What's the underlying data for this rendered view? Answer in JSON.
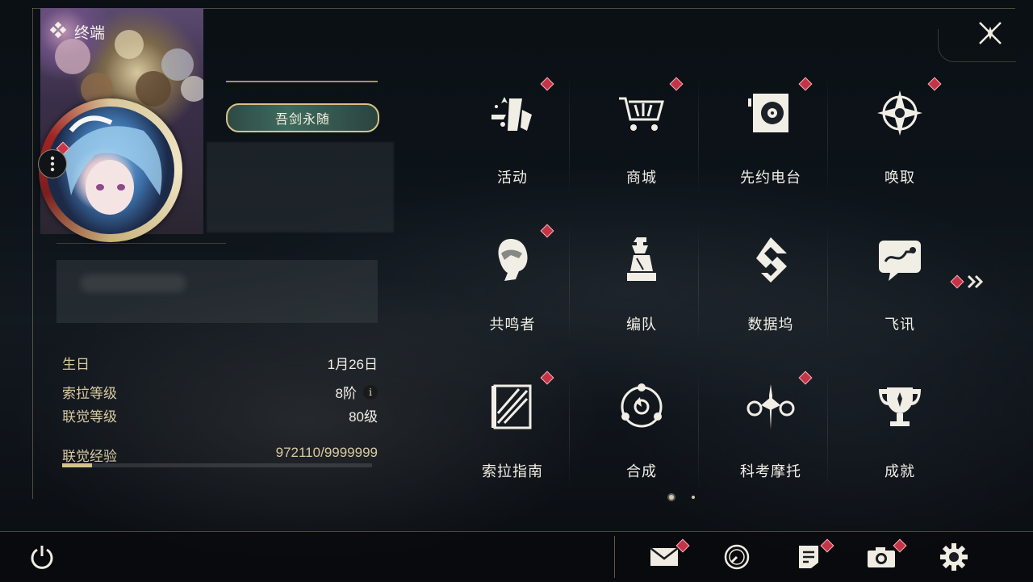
{
  "header": {
    "title": "终端"
  },
  "profile": {
    "title_badge": "吾剑永随",
    "stats": [
      {
        "label": "生日",
        "value": "1月26日"
      },
      {
        "label": "索拉等级",
        "value": "8阶"
      },
      {
        "label": "联觉等级",
        "value": "80级"
      }
    ],
    "exp": {
      "label": "联觉经验",
      "value": "972110/9999999",
      "fraction": 0.097
    }
  },
  "menu": {
    "items": [
      {
        "label": "活动",
        "icon": "activity-icon",
        "badge": true
      },
      {
        "label": "商城",
        "icon": "shop-cart-icon",
        "badge": true
      },
      {
        "label": "先约电台",
        "icon": "radio-icon",
        "badge": true
      },
      {
        "label": "唤取",
        "icon": "gacha-compass-icon",
        "badge": true
      },
      {
        "label": "共鸣者",
        "icon": "resonator-icon",
        "badge": true
      },
      {
        "label": "编队",
        "icon": "team-chess-icon",
        "badge": false
      },
      {
        "label": "数据坞",
        "icon": "data-dock-icon",
        "badge": false
      },
      {
        "label": "飞讯",
        "icon": "message-icon",
        "badge": false
      },
      {
        "label": "索拉指南",
        "icon": "guide-icon",
        "badge": true
      },
      {
        "label": "合成",
        "icon": "synthesis-icon",
        "badge": false
      },
      {
        "label": "科考摩托",
        "icon": "motorcycle-icon",
        "badge": true
      },
      {
        "label": "成就",
        "icon": "trophy-icon",
        "badge": false
      }
    ],
    "next_page_icon": "double-chevron-right-icon",
    "pages": 2,
    "current_page": 1
  },
  "bottom_bar": {
    "icons": [
      "power-icon",
      "mail-icon",
      "clock-icon",
      "notes-icon",
      "camera-icon",
      "settings-gear-icon"
    ]
  },
  "colors": {
    "accent_gold": "#d6c389",
    "badge_red": "#c53446"
  }
}
